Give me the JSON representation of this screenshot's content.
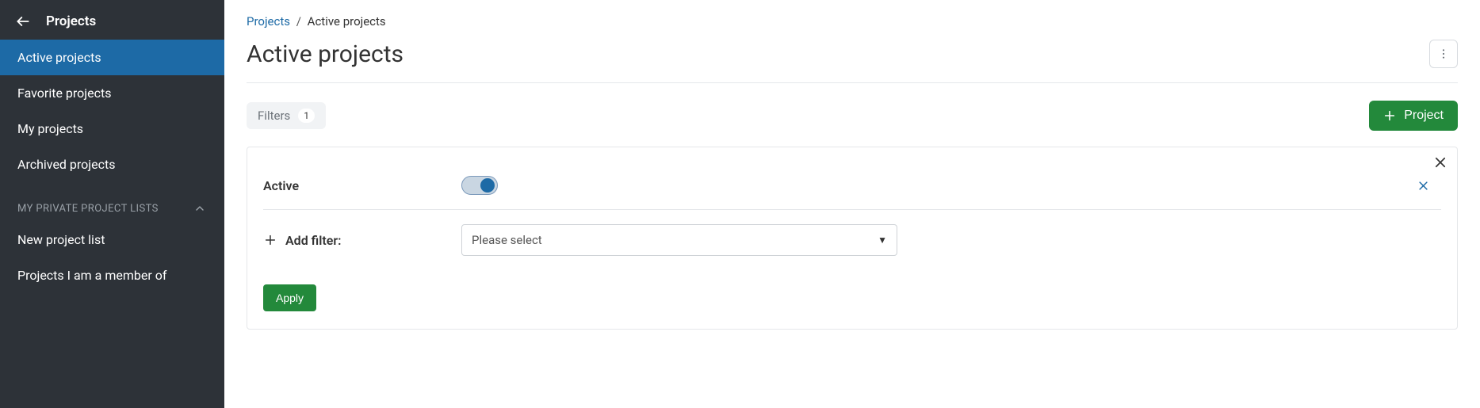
{
  "sidebar": {
    "title": "Projects",
    "items": [
      {
        "label": "Active projects",
        "active": true
      },
      {
        "label": "Favorite projects",
        "active": false
      },
      {
        "label": "My projects",
        "active": false
      },
      {
        "label": "Archived projects",
        "active": false
      }
    ],
    "section_label": "MY PRIVATE PROJECT LISTS",
    "private_items": [
      {
        "label": "New project list"
      },
      {
        "label": "Projects I am a member of"
      }
    ]
  },
  "breadcrumb": {
    "root": "Projects",
    "sep": "/",
    "current": "Active projects"
  },
  "page_title": "Active projects",
  "toolbar": {
    "filters_label": "Filters",
    "filters_count": "1",
    "create_label": "Project"
  },
  "filters": {
    "rows": [
      {
        "label": "Active"
      }
    ],
    "add_label": "Add filter:",
    "select_placeholder": "Please select",
    "apply_label": "Apply"
  }
}
